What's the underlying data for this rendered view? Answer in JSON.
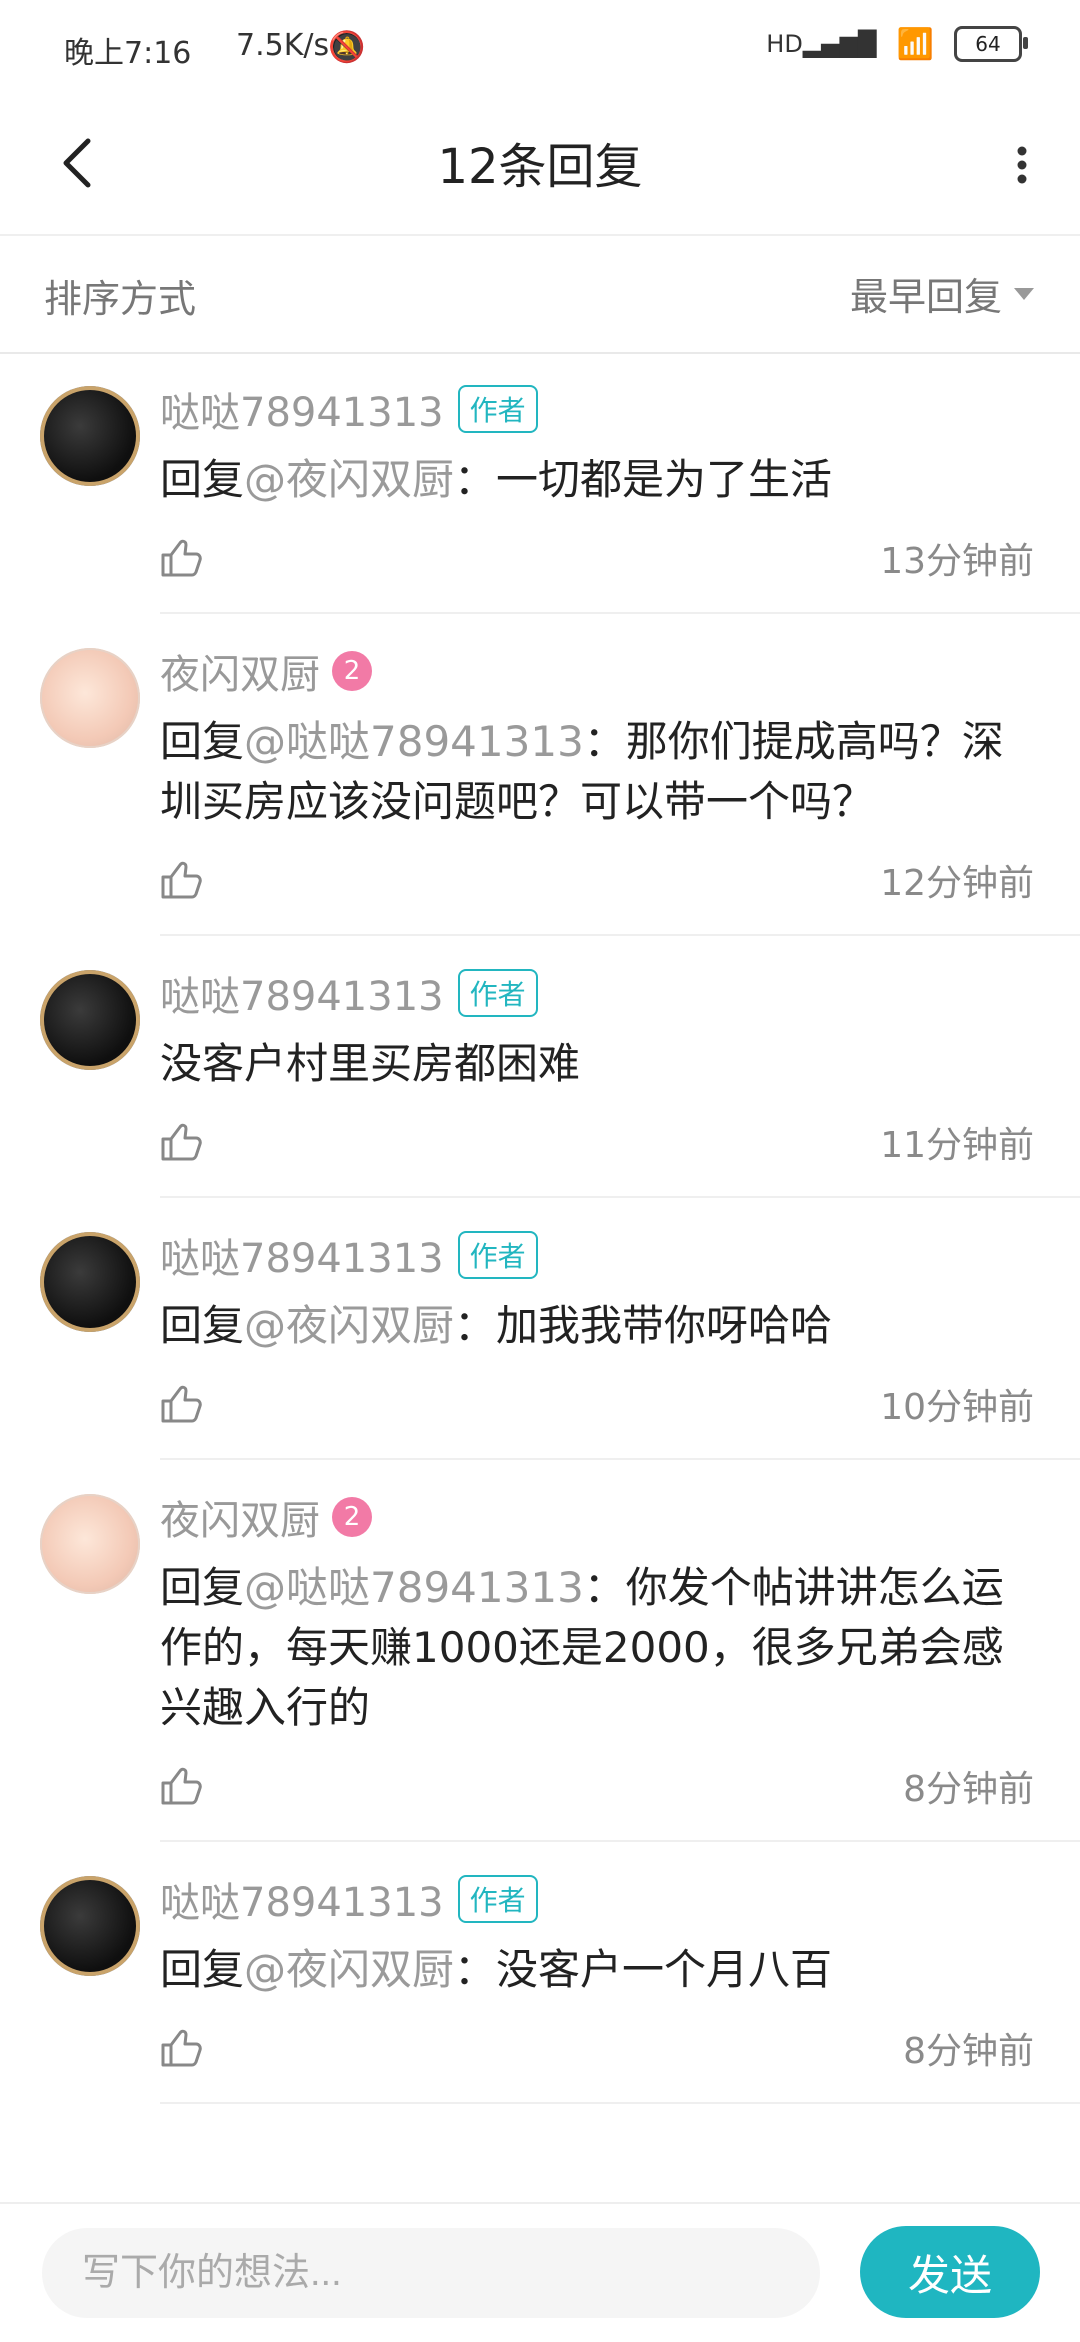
{
  "status_bar": {
    "time": "晚上7:16",
    "speed": "7.5K/s",
    "network": "HD",
    "battery": "64"
  },
  "header": {
    "title": "12条回复"
  },
  "sort_bar": {
    "label": "排序方式",
    "selected": "最早回复"
  },
  "replies": [
    {
      "name": "哒哒78941313",
      "tag": "作者",
      "content_prefix": "回复",
      "mention": "@夜闪双厨",
      "text": "：一切都是为了生活",
      "time": "13分钟前"
    },
    {
      "name": "夜闪双厨",
      "badge": "2",
      "content_prefix": "回复",
      "mention": "@哒哒78941313",
      "text": "：那你们提成高吗？深圳买房应该没问题吧？可以带一个吗？",
      "time": "12分钟前"
    },
    {
      "name": "哒哒78941313",
      "tag": "作者",
      "text": "没客户村里买房都困难",
      "time": "11分钟前"
    },
    {
      "name": "哒哒78941313",
      "tag": "作者",
      "content_prefix": "回复",
      "mention": "@夜闪双厨",
      "text": "：加我我带你呀哈哈",
      "time": "10分钟前"
    },
    {
      "name": "夜闪双厨",
      "badge": "2",
      "content_prefix": "回复",
      "mention": "@哒哒78941313",
      "text": "：你发个帖讲讲怎么运作的，每天赚1000还是2000，很多兄弟会感兴趣入行的",
      "time": "8分钟前"
    },
    {
      "name": "哒哒78941313",
      "tag": "作者",
      "content_prefix": "回复",
      "mention": "@夜闪双厨",
      "text": "：没客户一个月八百",
      "time": "8分钟前"
    }
  ],
  "footer": {
    "placeholder": "写下你的想法...",
    "send_label": "发送"
  },
  "colors": {
    "accent": "#1fb6c1",
    "badge_pink": "#f27aa6"
  }
}
